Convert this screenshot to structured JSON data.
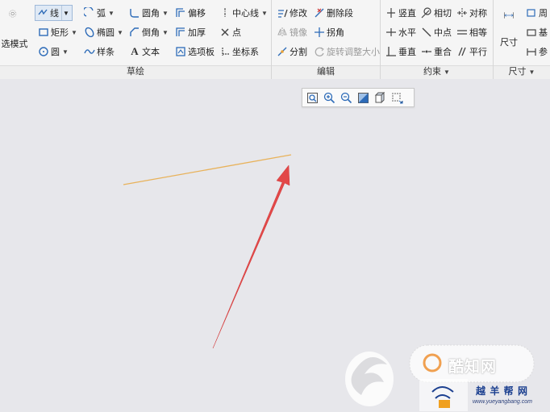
{
  "ribbon": {
    "sketch_group": {
      "label": "草绘",
      "mode_label": "选模式",
      "line": "线",
      "arc": "弧",
      "fillet": "圆角",
      "offset": "偏移",
      "centerline": "中心线",
      "rectangle": "矩形",
      "ellipse": "椭圆",
      "chamfer": "倒角",
      "thicken": "加厚",
      "point": "点",
      "circle": "圆",
      "spline": "样条",
      "text": "文本",
      "palette": "选项板",
      "coord_system": "坐标系"
    },
    "edit_group": {
      "label": "编辑",
      "modify": "修改",
      "delete_segment": "删除段",
      "mirror": "镜像",
      "corner": "拐角",
      "divide": "分割",
      "rotate_resize": "旋转调整大小"
    },
    "constrain_group": {
      "label": "约束",
      "vertical": "竖直",
      "tangent": "相切",
      "symmetric": "对称",
      "horizontal": "水平",
      "midpoint": "中点",
      "equal": "相等",
      "perpendicular": "垂直",
      "coincident": "重合",
      "parallel": "平行"
    },
    "dimension_group": {
      "label": "尺寸",
      "dimension": "尺寸",
      "perimeter": "周",
      "base": "基",
      "reference": "参"
    }
  },
  "watermark": {
    "title": "酷知网",
    "brand": "越 羊 帮 网",
    "url": "www.yueyangbang.com"
  },
  "colors": {
    "sketch_line": "#e8b25a",
    "arrow": "#e23b3b",
    "accent_blue": "#2d6bb8"
  }
}
